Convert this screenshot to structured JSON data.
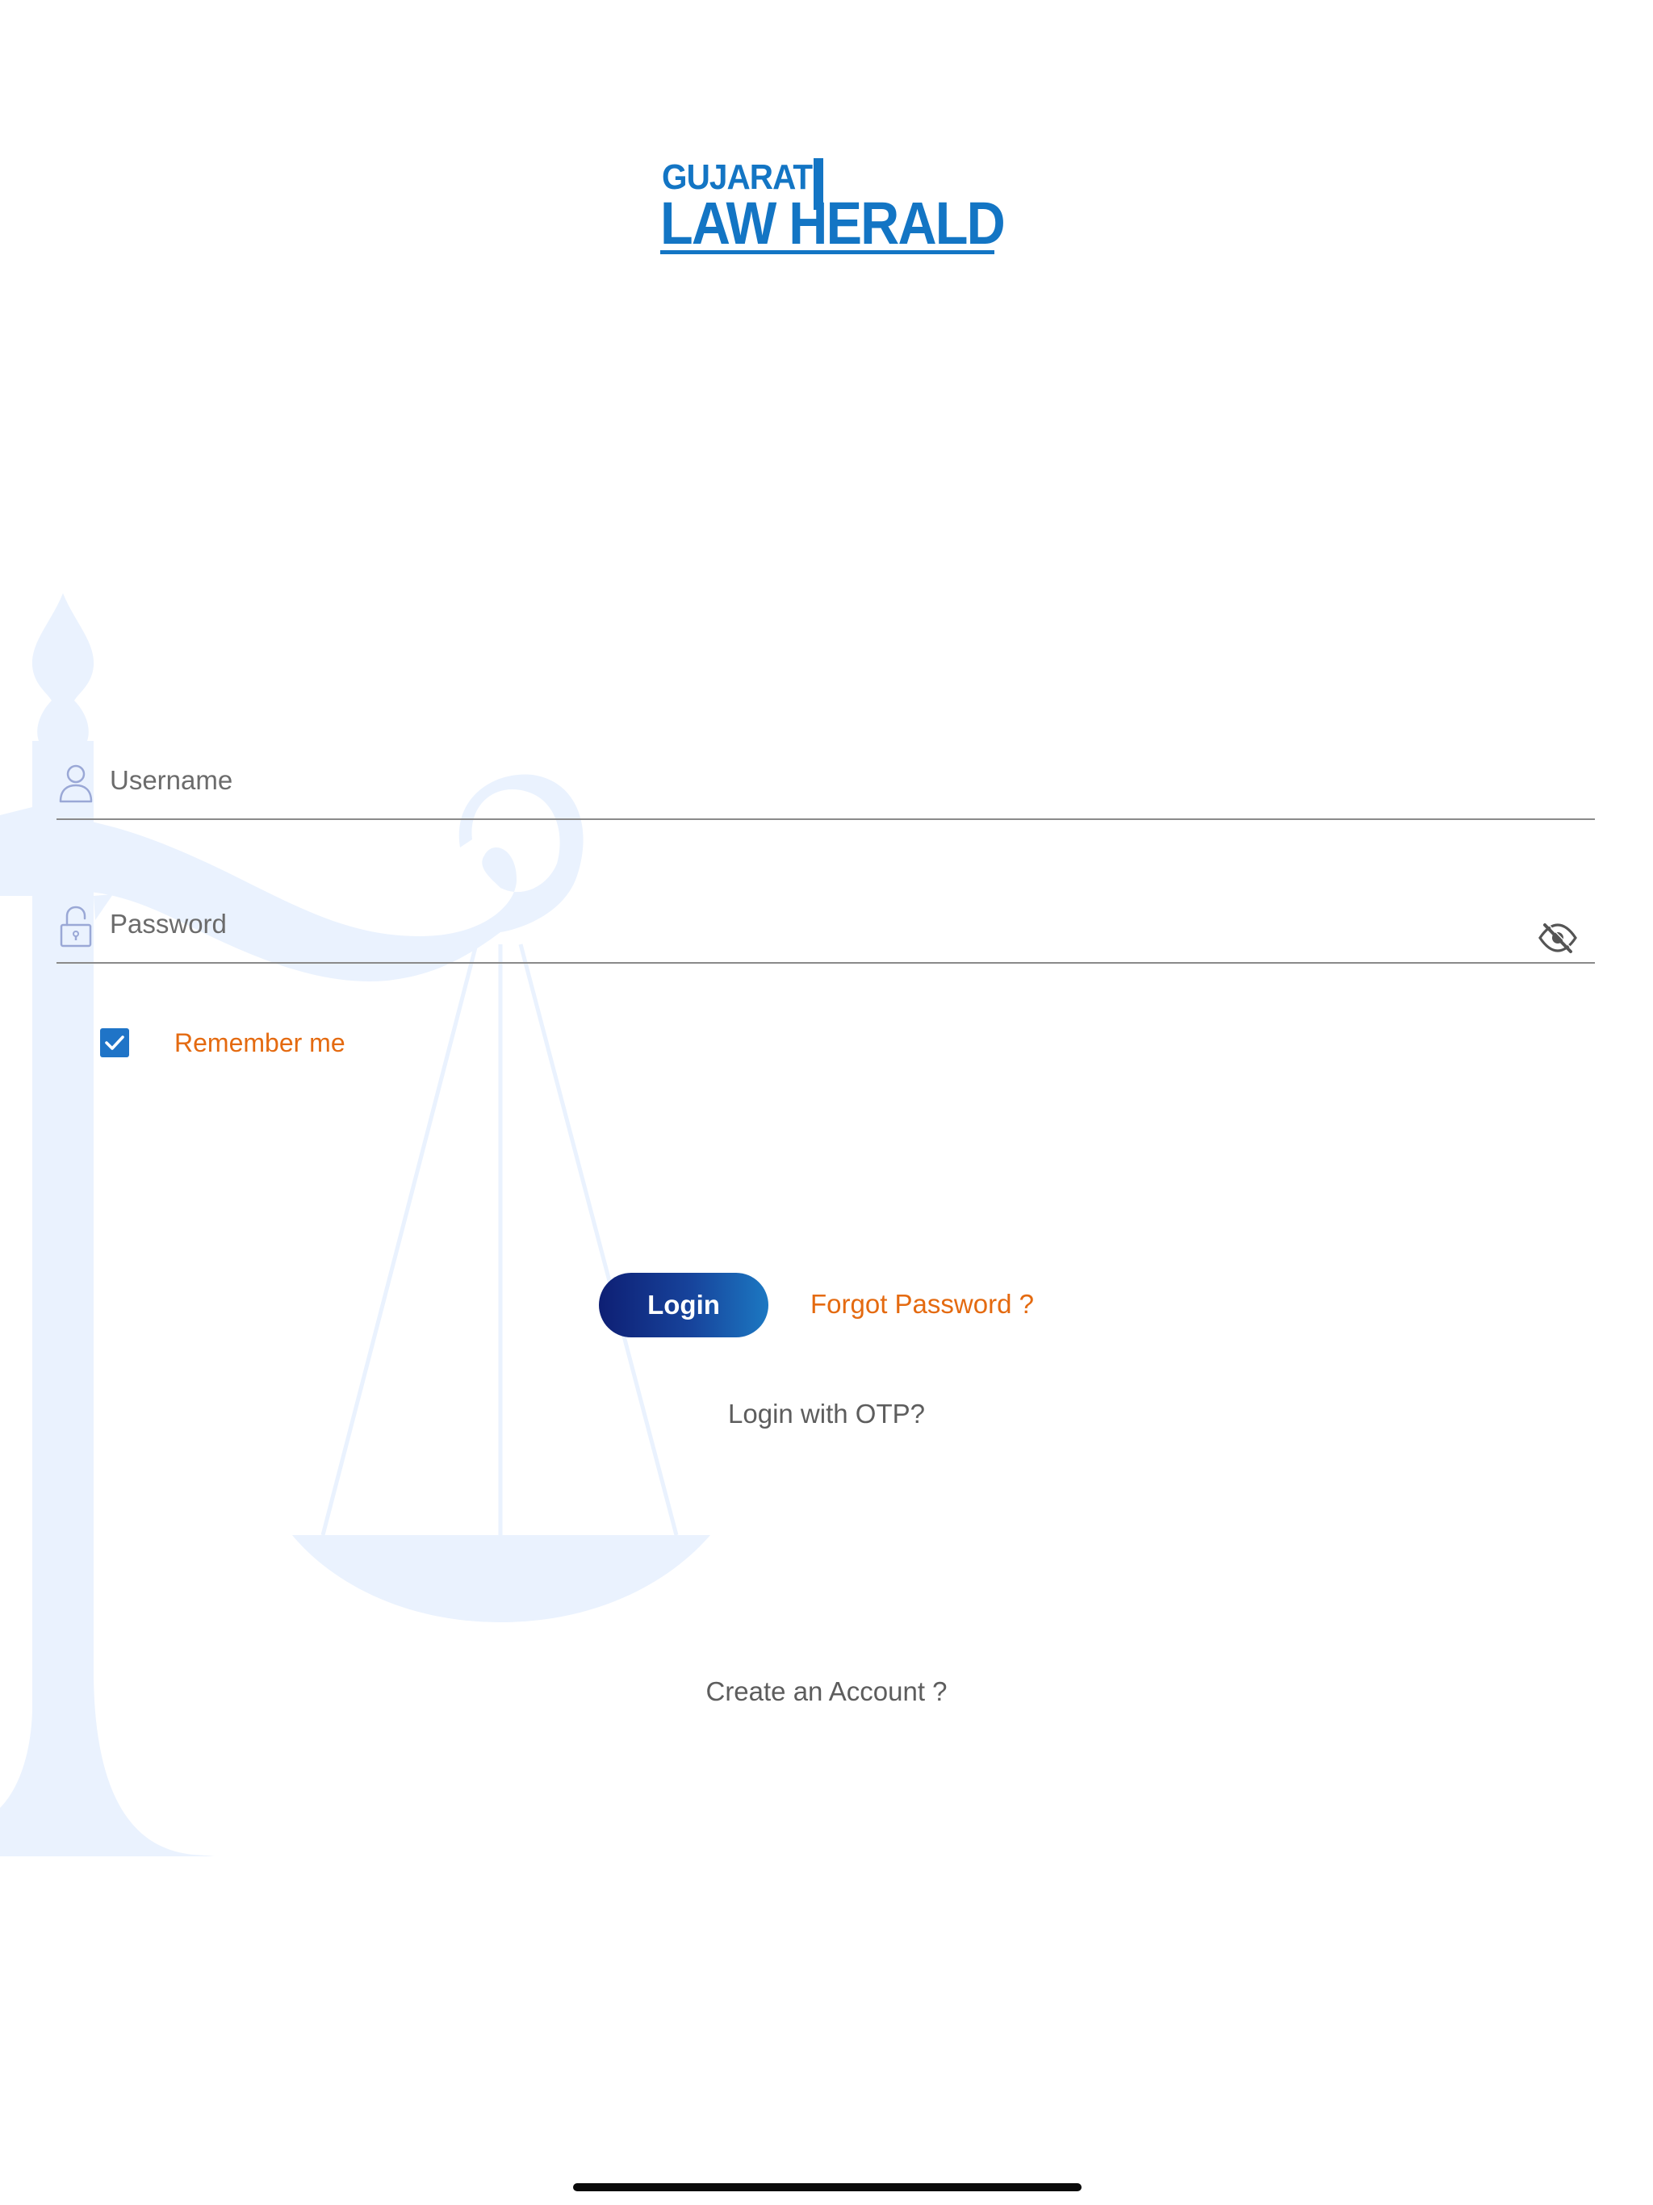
{
  "logo": {
    "line1": "GUJARAT",
    "line2": "LAW HERALD",
    "color": "#1375c4"
  },
  "background": {
    "icon": "scales-of-justice-icon",
    "color": "#eaf2fe"
  },
  "form": {
    "username": {
      "icon": "user-icon",
      "placeholder": "Username",
      "value": ""
    },
    "password": {
      "icon": "lock-icon",
      "placeholder": "Password",
      "value": "",
      "toggle_icon": "eye-slash-icon"
    },
    "remember": {
      "label": "Remember me",
      "checked": true
    }
  },
  "actions": {
    "login_label": "Login",
    "forgot_label": "Forgot Password ?",
    "otp_label": "Login with OTP?",
    "create_label": "Create an Account ?"
  },
  "colors": {
    "accent_orange": "#e46a10",
    "checkbox_blue": "#1f74c7",
    "button_gradient_start": "#0e1f74",
    "button_gradient_end": "#1c78c2",
    "muted_text": "#5d5d5d"
  }
}
